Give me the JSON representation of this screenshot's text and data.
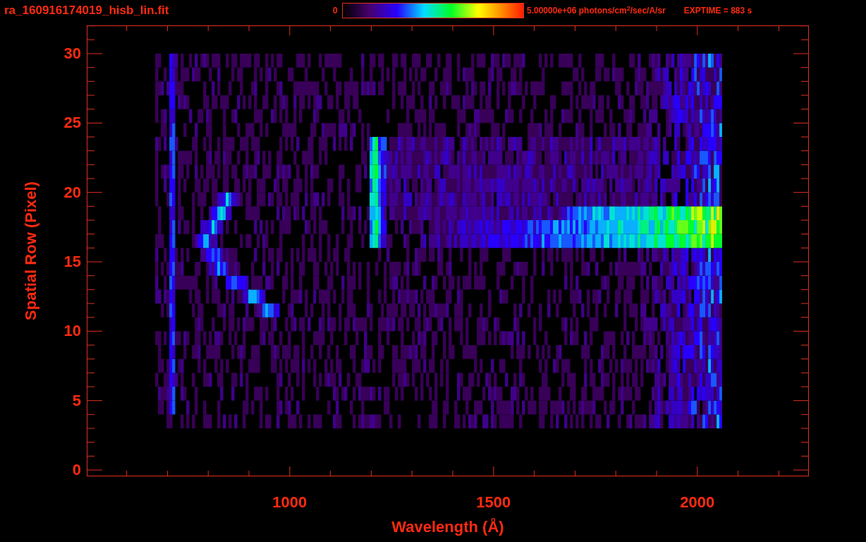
{
  "header": {
    "file_name": "ra_160916174019_hisb_lin.fit",
    "colorbar_min": "0",
    "colorbar_max": "5.00000e+06 photons/cm$^{2}$/sec/A/sr",
    "exposure": "EXPTIME = 883 s"
  },
  "plot": {
    "x_label": "Wavelength (Å)",
    "y_label": "Spatial Row (Pixel)",
    "x_tick_labels": [
      "1000",
      "1500",
      "2000"
    ],
    "y_tick_labels": [
      "30",
      "25",
      "20",
      "15",
      "10",
      "5",
      "0"
    ]
  }
}
